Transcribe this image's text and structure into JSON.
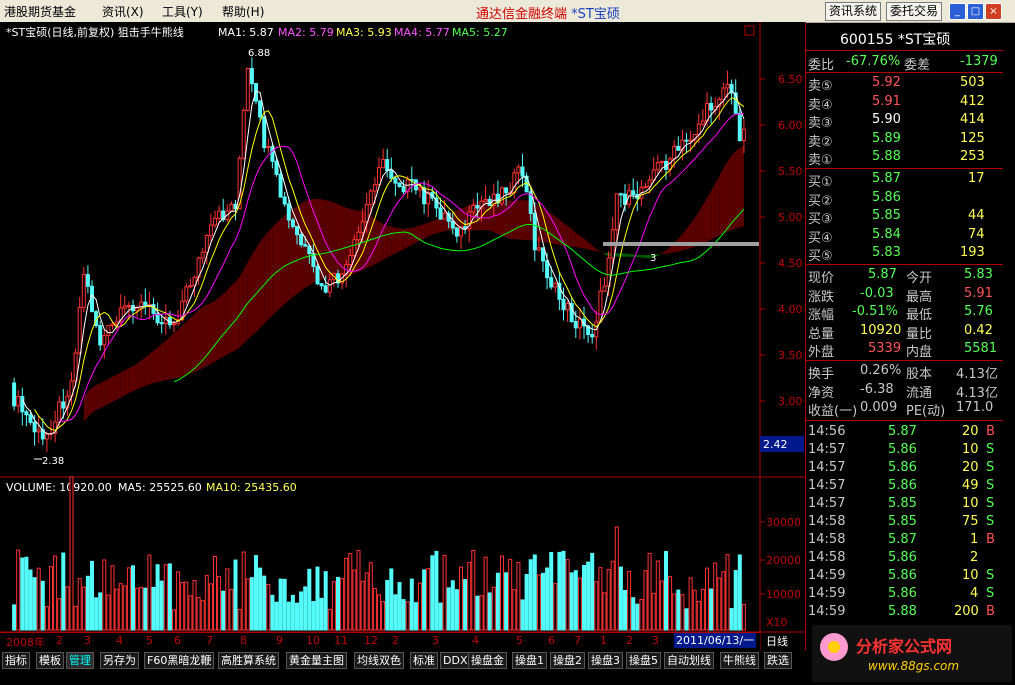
{
  "menu": {
    "items": [
      "港股期货基金",
      "资讯(X)",
      "工具(Y)",
      "帮助(H)"
    ],
    "title": "通达信金融终端",
    "title_stock": "*ST宝硕",
    "btn_info": "资讯系统",
    "btn_trade": "委托交易"
  },
  "chart": {
    "header": "*ST宝硕(日线,前复权) 狙击手牛熊线",
    "ma1": "MA1: 5.87",
    "ma2": "MA2: 5.79",
    "ma3": "MA3: 5.93",
    "ma4": "MA4: 5.77",
    "ma5": "MA5: 5.27",
    "volume_header": "VOLUME: 10920.00",
    "vol_ma5": "MA5: 25525.60",
    "vol_ma10": "MA10: 25435.60",
    "high_label": "6.88",
    "low_label": "2.38",
    "mid_label": "3",
    "current_price_tag": "2.42",
    "price_axis": [
      "6.50",
      "6.00",
      "5.50",
      "5.00",
      "4.50",
      "4.00",
      "3.50",
      "3.00"
    ],
    "vol_axis": [
      "30000",
      "20000",
      "10000"
    ],
    "vol_scale": "X10",
    "date_label": "2011/06/13/一",
    "period": "日线",
    "months": [
      "2008年",
      "2",
      "3",
      "4",
      "5",
      "6",
      "7",
      "8",
      "9",
      "10",
      "11",
      "12",
      "2",
      "3",
      "4",
      "5",
      "6",
      "7",
      "1",
      "2",
      "3"
    ],
    "colors": {
      "up": "#ff3232",
      "down": "#54fcfc",
      "ma1": "#ffffff",
      "ma2": "#ffff00",
      "ma3": "#ff00ff",
      "ma4": "#00ff00",
      "band_up": "#5a0000",
      "band_down": "#005a00"
    }
  },
  "quote": {
    "code_name": "600155 *ST宝硕",
    "weibi_label": "委比",
    "weibi": "-67.76%",
    "weicha_label": "委差",
    "weicha": "-1379",
    "sells": [
      {
        "label": "卖⑤",
        "price": "5.92",
        "vol": "503"
      },
      {
        "label": "卖④",
        "price": "5.91",
        "vol": "412"
      },
      {
        "label": "卖③",
        "price": "5.90",
        "vol": "414"
      },
      {
        "label": "卖②",
        "price": "5.89",
        "vol": "125"
      },
      {
        "label": "卖①",
        "price": "5.88",
        "vol": "253"
      }
    ],
    "buys": [
      {
        "label": "买①",
        "price": "5.87",
        "vol": "17"
      },
      {
        "label": "买②",
        "price": "5.86",
        "vol": ""
      },
      {
        "label": "买③",
        "price": "5.85",
        "vol": "44"
      },
      {
        "label": "买④",
        "price": "5.84",
        "vol": "74"
      },
      {
        "label": "买⑤",
        "price": "5.83",
        "vol": "193"
      }
    ],
    "stats": [
      {
        "l1": "现价",
        "v1": "5.87",
        "l2": "今开",
        "v2": "5.83"
      },
      {
        "l1": "涨跌",
        "v1": "-0.03",
        "l2": "最高",
        "v2": "5.91"
      },
      {
        "l1": "涨幅",
        "v1": "-0.51%",
        "l2": "最低",
        "v2": "5.76"
      },
      {
        "l1": "总量",
        "v1": "10920",
        "l2": "量比",
        "v2": "0.42"
      },
      {
        "l1": "外盘",
        "v1": "5339",
        "l2": "内盘",
        "v2": "5581"
      }
    ],
    "stats2": [
      {
        "l1": "换手",
        "v1": "0.26%",
        "l2": "股本",
        "v2": "4.13亿"
      },
      {
        "l1": "净资",
        "v1": "-6.38",
        "l2": "流通",
        "v2": "4.13亿"
      },
      {
        "l1": "收益(一)",
        "v1": "0.009",
        "l2": "PE(动)",
        "v2": "171.0"
      }
    ],
    "ticks": [
      {
        "time": "14:56",
        "price": "5.87",
        "vol": "20",
        "bs": "B"
      },
      {
        "time": "14:57",
        "price": "5.86",
        "vol": "10",
        "bs": "S"
      },
      {
        "time": "14:57",
        "price": "5.86",
        "vol": "20",
        "bs": "S"
      },
      {
        "time": "14:57",
        "price": "5.86",
        "vol": "49",
        "bs": "S"
      },
      {
        "time": "14:57",
        "price": "5.85",
        "vol": "10",
        "bs": "S"
      },
      {
        "time": "14:58",
        "price": "5.85",
        "vol": "75",
        "bs": "S"
      },
      {
        "time": "14:58",
        "price": "5.87",
        "vol": "1",
        "bs": "B"
      },
      {
        "time": "14:58",
        "price": "5.86",
        "vol": "2",
        "bs": ""
      },
      {
        "time": "14:59",
        "price": "5.86",
        "vol": "10",
        "bs": "S"
      },
      {
        "time": "14:59",
        "price": "5.86",
        "vol": "4",
        "bs": "S"
      },
      {
        "time": "14:59",
        "price": "5.88",
        "vol": "200",
        "bs": "B"
      }
    ]
  },
  "tabs": [
    "指标",
    "模板",
    "管理",
    "另存为",
    "F60黑暗龙鞭",
    "高胜算系统",
    "黄金量主图",
    "均线双色",
    "标准",
    "DDX",
    "操盘金",
    "操盘1",
    "操盘2",
    "操盘3",
    "操盘5",
    "自动划线",
    "牛熊线",
    "跌选"
  ],
  "logo": {
    "name": "分析家公式网",
    "url": "www.88gs.com"
  }
}
